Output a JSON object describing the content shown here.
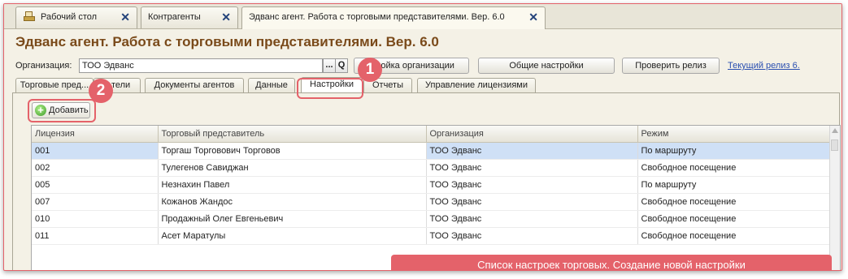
{
  "top_tabs": [
    {
      "label": "Рабочий стол"
    },
    {
      "label": "Контрагенты"
    },
    {
      "label": "Эдванс агент. Работа с торговыми представителями. Вер. 6.0"
    }
  ],
  "close_glyph": "✕",
  "page_title": "Эдванс агент. Работа с торговыми представителями. Вер. 6.0",
  "org": {
    "label": "Организация:",
    "value": "ТОО Эдванс",
    "select_glyph": "...",
    "search_glyph": "Q"
  },
  "toolbar": {
    "org_settings": "...ройка организации",
    "general_settings": "Общие настройки",
    "check_release": "Проверить релиз",
    "current_release": "Текущий релиз 6."
  },
  "subtabs": [
    {
      "label": "Торговые пред..."
    },
    {
      "label": "...тели"
    },
    {
      "label": "Документы агентов"
    },
    {
      "label": "Данные"
    },
    {
      "label": "Настройки"
    },
    {
      "label": "Отчеты"
    },
    {
      "label": "Управление лицензиями"
    }
  ],
  "add_button": {
    "label": "Добавить",
    "icon": "plus-icon"
  },
  "table": {
    "columns": [
      "Лицензия",
      "Торговый представитель",
      "Организация",
      "Режим"
    ],
    "rows": [
      [
        "001",
        "Торгаш Торговович Торговов",
        "ТОО Эдванс",
        "По маршруту"
      ],
      [
        "002",
        "Тулегенов Савиджан",
        "ТОО Эдванс",
        "Свободное посещение"
      ],
      [
        "005",
        "Незнахин Павел",
        "ТОО Эдванс",
        "По маршруту"
      ],
      [
        "007",
        "Кожанов Жандос",
        "ТОО Эдванс",
        "Свободное посещение"
      ],
      [
        "010",
        "Продажный Олег Евгеньевич",
        "ТОО Эдванс",
        "Свободное посещение"
      ],
      [
        "011",
        "Асет Маратулы",
        "ТОО Эдванс",
        "Свободное посещение"
      ]
    ],
    "selected_row": 0
  },
  "markers": [
    "1",
    "2"
  ],
  "caption": "Список настроек торговых. Создание новой настройки",
  "colors": {
    "accent": "#e4626a",
    "title": "#7a4a1a",
    "selection": "#cfe0f6",
    "link": "#2a4fb0"
  }
}
